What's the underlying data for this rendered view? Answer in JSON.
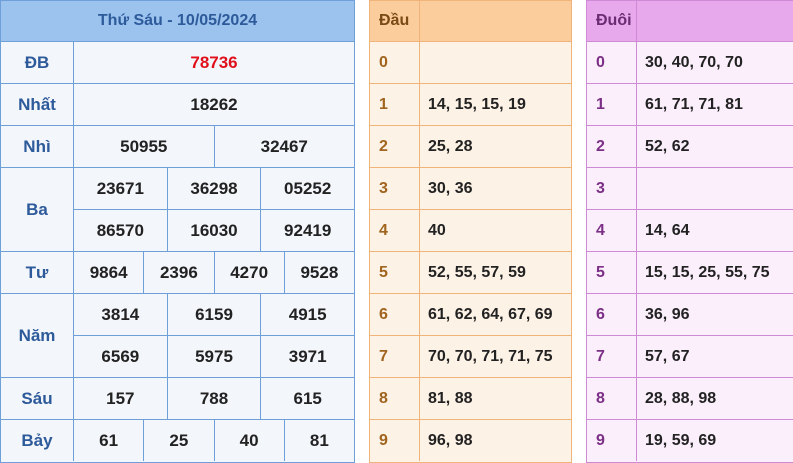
{
  "results": {
    "title": "Thứ Sáu - 10/05/2024",
    "prizes": [
      {
        "label": "ĐB",
        "lines": [
          [
            "78736"
          ]
        ]
      },
      {
        "label": "Nhất",
        "lines": [
          [
            "18262"
          ]
        ]
      },
      {
        "label": "Nhì",
        "lines": [
          [
            "50955",
            "32467"
          ]
        ]
      },
      {
        "label": "Ba",
        "lines": [
          [
            "23671",
            "36298",
            "05252"
          ],
          [
            "86570",
            "16030",
            "92419"
          ]
        ]
      },
      {
        "label": "Tư",
        "lines": [
          [
            "9864",
            "2396",
            "4270",
            "9528"
          ]
        ]
      },
      {
        "label": "Năm",
        "lines": [
          [
            "3814",
            "6159",
            "4915"
          ],
          [
            "6569",
            "5975",
            "3971"
          ]
        ]
      },
      {
        "label": "Sáu",
        "lines": [
          [
            "157",
            "788",
            "615"
          ]
        ]
      },
      {
        "label": "Bảy",
        "lines": [
          [
            "61",
            "25",
            "40",
            "81"
          ]
        ]
      }
    ]
  },
  "dau": {
    "header": "Đầu",
    "rows": [
      {
        "digit": "0",
        "values": ""
      },
      {
        "digit": "1",
        "values": "14, 15, 15, 19"
      },
      {
        "digit": "2",
        "values": "25, 28"
      },
      {
        "digit": "3",
        "values": "30, 36"
      },
      {
        "digit": "4",
        "values": "40"
      },
      {
        "digit": "5",
        "values": "52, 55, 57, 59"
      },
      {
        "digit": "6",
        "values": "61, 62, 64, 67, 69"
      },
      {
        "digit": "7",
        "values": "70, 70, 71, 71, 75"
      },
      {
        "digit": "8",
        "values": "81, 88"
      },
      {
        "digit": "9",
        "values": "96, 98"
      }
    ]
  },
  "duoi": {
    "header": "Đuôi",
    "rows": [
      {
        "digit": "0",
        "values": "30, 40, 70, 70"
      },
      {
        "digit": "1",
        "values": "61, 71, 71, 81"
      },
      {
        "digit": "2",
        "values": "52, 62"
      },
      {
        "digit": "3",
        "values": ""
      },
      {
        "digit": "4",
        "values": "14, 64"
      },
      {
        "digit": "5",
        "values": "15, 15, 25, 55, 75"
      },
      {
        "digit": "6",
        "values": "36, 96"
      },
      {
        "digit": "7",
        "values": "57, 67"
      },
      {
        "digit": "8",
        "values": "28, 88, 98"
      },
      {
        "digit": "9",
        "values": "19, 59, 69"
      }
    ]
  },
  "colors": {
    "special_prize": "#e0101b",
    "results_header": "#9cc3ee",
    "dau_header": "#fbcd9c",
    "duoi_header": "#e8a9ec"
  }
}
